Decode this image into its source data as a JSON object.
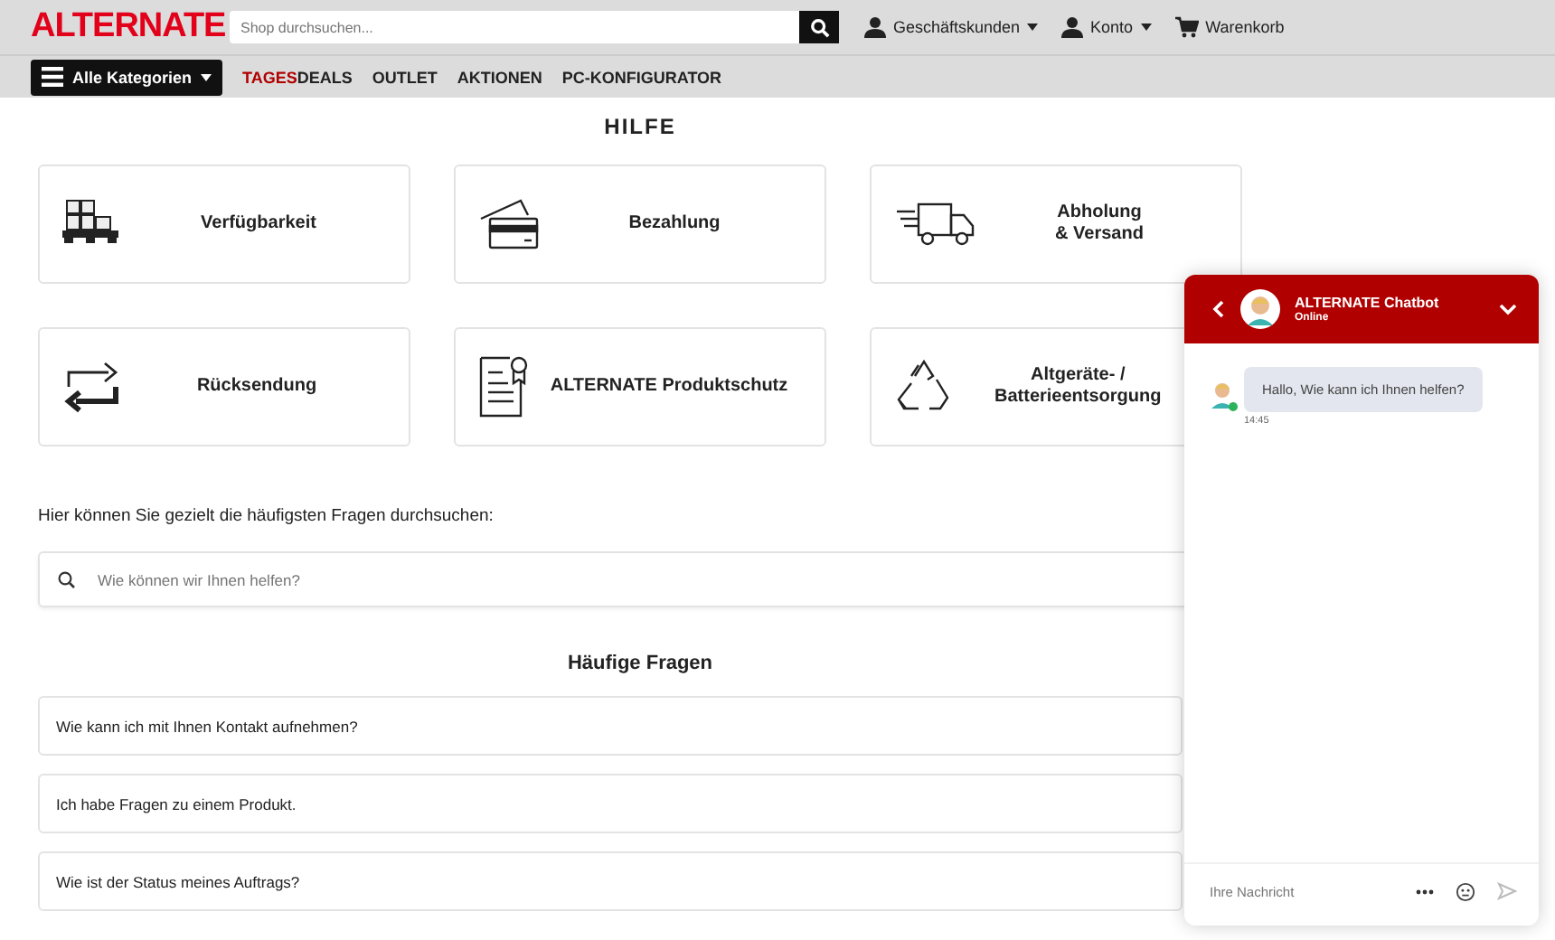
{
  "header": {
    "logo": "ALTERNATE",
    "search": {
      "placeholder": "Shop durchsuchen..."
    },
    "links": [
      {
        "label": "Geschäftskunden",
        "kind": "user",
        "dropdown": true
      },
      {
        "label": "Konto",
        "kind": "user",
        "dropdown": true
      },
      {
        "label": "Warenkorb",
        "kind": "cart",
        "dropdown": false
      }
    ]
  },
  "nav": {
    "categories": "Alle Kategorien",
    "items": [
      {
        "highlight": "TAGES",
        "label": "DEALS"
      },
      {
        "label": "OUTLET"
      },
      {
        "label": "AKTIONEN"
      },
      {
        "label": "PC-KONFIGURATOR"
      }
    ]
  },
  "title": "HILFE",
  "cards": [
    {
      "label": "Verfügbarkeit"
    },
    {
      "label": "Bezahlung"
    },
    {
      "label": "Abholung\n& Versand"
    },
    {
      "label": "Rücksendung"
    },
    {
      "label": "ALTERNATE Produktschutz"
    },
    {
      "label": "Altgeräte- /\nBatterieentsorgung"
    }
  ],
  "search_intro": "Hier können Sie gezielt die häufigsten Fragen durchsuchen:",
  "faq_search": {
    "placeholder": "Wie können wir Ihnen helfen?"
  },
  "faq": {
    "title": "Häufige Fragen",
    "items": [
      "Wie kann ich mit Ihnen Kontakt aufnehmen?",
      "Ich habe Fragen zu einem Produkt.",
      "Wie ist der Status meines Auftrags?"
    ]
  },
  "chat": {
    "name": "ALTERNATE Chatbot",
    "status": "Online",
    "online": true,
    "messages": [
      {
        "text": "Hallo, Wie kann ich Ihnen helfen?",
        "time": "14:45"
      }
    ],
    "input": {
      "placeholder": "Ihre Nachricht"
    }
  }
}
